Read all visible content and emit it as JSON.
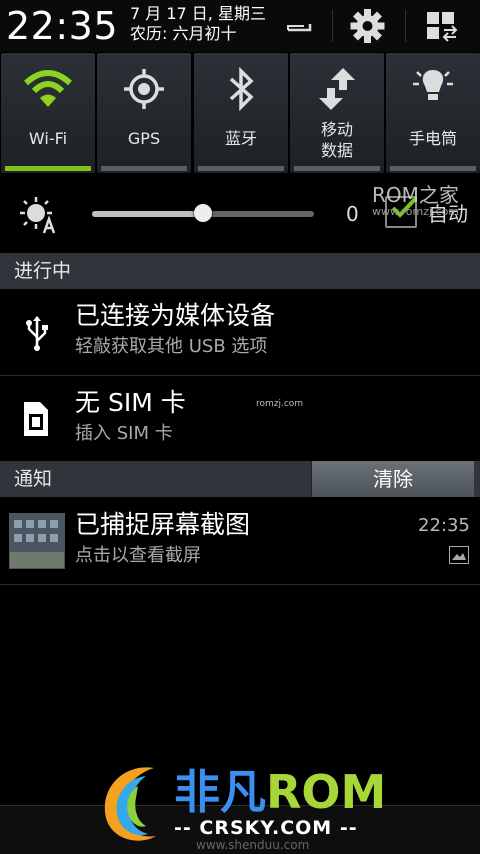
{
  "header": {
    "time": "22:35",
    "date_line1": "7 月 17 日, 星期三",
    "date_line2": "农历: 六月初十"
  },
  "toggles": [
    {
      "label": "Wi-Fi",
      "on": true,
      "icon": "wifi-icon"
    },
    {
      "label": "GPS",
      "on": false,
      "icon": "gps-icon"
    },
    {
      "label": "蓝牙",
      "on": false,
      "icon": "bluetooth-icon"
    },
    {
      "label_line1": "移动",
      "label_line2": "数据",
      "on": false,
      "icon": "mobile-data-icon"
    },
    {
      "label": "手电筒",
      "on": false,
      "icon": "flashlight-icon"
    }
  ],
  "brightness": {
    "value": "0",
    "level": 0.5,
    "auto_label": "自动",
    "auto_checked": true
  },
  "ongoing": {
    "title": "进行中",
    "items": [
      {
        "title": "已连接为媒体设备",
        "subtitle": "轻敲获取其他 USB 选项",
        "icon": "usb-icon"
      },
      {
        "title": "无 SIM 卡",
        "subtitle": "插入 SIM 卡",
        "icon": "sim-card-icon"
      }
    ]
  },
  "notifications": {
    "title": "通知",
    "clear_label": "清除",
    "items": [
      {
        "title": "已捕捉屏幕截图",
        "subtitle": "点击以查看截屏",
        "time": "22:35",
        "icon": "gallery-icon"
      }
    ]
  },
  "watermarks": {
    "rom_home": "ROM之家",
    "rom_home_url": "www.romzj.com",
    "romzj_small": "romzj.com",
    "logo_cn": "非凡",
    "logo_rom": "ROM",
    "logo_sub": "-- CRSKY.COM --",
    "logo_url": "www.shenduu.com"
  },
  "colors": {
    "accent_on": "#7ec21a",
    "tile_bg": "#2c3137",
    "section_bg": "#2f353a"
  }
}
